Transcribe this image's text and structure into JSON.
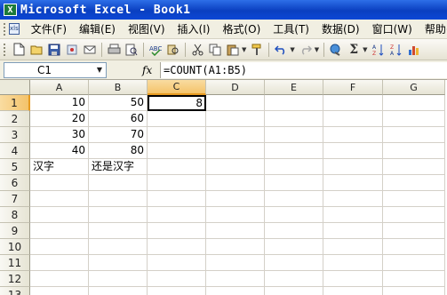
{
  "window": {
    "title": "Microsoft Excel - Book1",
    "icon_letter": "X"
  },
  "menu": {
    "doc_icon_label": "xls",
    "items": [
      "文件(F)",
      "编辑(E)",
      "视图(V)",
      "插入(I)",
      "格式(O)",
      "工具(T)",
      "数据(D)",
      "窗口(W)",
      "帮助(H)"
    ]
  },
  "toolbar": {
    "buttons": [
      "new-icon",
      "open-icon",
      "save-icon",
      "permission-icon",
      "email-icon",
      "print-icon",
      "print-preview-icon",
      "spelling-icon",
      "research-icon",
      "cut-icon",
      "copy-icon",
      "paste-icon",
      "format-painter-icon",
      "undo-icon",
      "redo-icon",
      "hyperlink-icon",
      "autosum-icon",
      "sort-ascending-icon",
      "sort-descending-icon",
      "chart-icon"
    ]
  },
  "formula_bar": {
    "name_box": "C1",
    "fx_label": "fx",
    "formula": "=COUNT(A1:B5)"
  },
  "sheet": {
    "columns": [
      "A",
      "B",
      "C",
      "D",
      "E",
      "F",
      "G"
    ],
    "rows": [
      "1",
      "2",
      "3",
      "4",
      "5",
      "6",
      "7",
      "8",
      "9",
      "10",
      "11",
      "12",
      "13"
    ],
    "active_cell": "C1",
    "cells": [
      [
        "10",
        "50",
        "8"
      ],
      [
        "20",
        "60",
        ""
      ],
      [
        "30",
        "70",
        ""
      ],
      [
        "40",
        "80",
        ""
      ],
      [
        "汉字",
        "还是汉字",
        ""
      ]
    ]
  }
}
